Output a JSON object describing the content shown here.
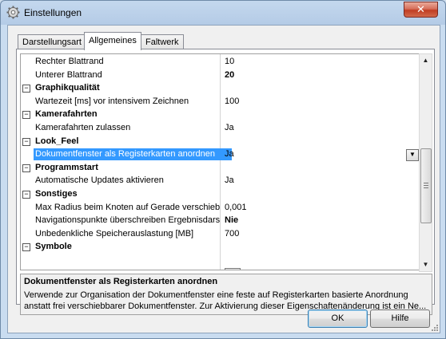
{
  "window": {
    "title": "Einstellungen",
    "close_label": "✕"
  },
  "tabs": [
    {
      "label": "Darstellungsart",
      "active": false
    },
    {
      "label": "Allgemeines",
      "active": true
    },
    {
      "label": "Faltwerk",
      "active": false
    }
  ],
  "grid": {
    "rows": [
      {
        "kind": "prop",
        "name": "Rechter Blattrand",
        "value": "10",
        "bold": false
      },
      {
        "kind": "prop",
        "name": "Unterer Blattrand",
        "value": "20",
        "bold": true
      },
      {
        "kind": "cat",
        "name": "Graphikqualität"
      },
      {
        "kind": "prop",
        "name": "Wartezeit [ms] vor intensivem Zeichnen",
        "value": "100",
        "bold": false
      },
      {
        "kind": "cat",
        "name": "Kamerafahrten"
      },
      {
        "kind": "prop",
        "name": "Kamerafahrten zulassen",
        "value": "Ja",
        "bold": false
      },
      {
        "kind": "cat",
        "name": "Look_Feel"
      },
      {
        "kind": "prop",
        "name": "Dokumentfenster als Registerkarten anordnen",
        "value": "Ja",
        "bold": false,
        "selected": true
      },
      {
        "kind": "cat",
        "name": "Programmstart"
      },
      {
        "kind": "prop",
        "name": "Automatische Updates aktivieren",
        "value": "Ja",
        "bold": false
      },
      {
        "kind": "cat",
        "name": "Sonstiges"
      },
      {
        "kind": "prop",
        "name": "Max Radius beim Knoten auf Gerade verschieb",
        "value": "0,001",
        "bold": false
      },
      {
        "kind": "prop",
        "name": "Navigationspunkte überschreiben Ergebnisdars",
        "value": "Nie",
        "bold": true
      },
      {
        "kind": "prop",
        "name": "Unbedenkliche Speicherauslastung [MB]",
        "value": "700",
        "bold": false
      },
      {
        "kind": "cat",
        "name": "Symbole"
      }
    ],
    "collapse_symbol": "−",
    "dropdown_symbol": "▼"
  },
  "scrollbar": {
    "up": "▲",
    "down": "▼"
  },
  "description": {
    "title": "Dokumentfenster als Registerkarten anordnen",
    "text": "Verwende zur Organisation der Dokumentfenster eine feste auf Registerkarten basierte Anordnung anstatt frei verschiebbarer Dokumentfenster. Zur Aktivierung dieser Eigenschaftenänderung ist ein Ne..."
  },
  "buttons": {
    "ok": "OK",
    "help": "Hilfe"
  },
  "colors": {
    "selection": "#3399ff",
    "close": "#c03d22"
  }
}
